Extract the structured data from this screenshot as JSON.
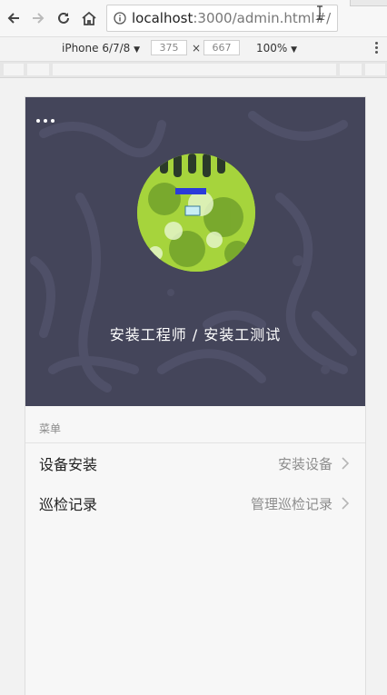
{
  "browser": {
    "url_host": "localhost",
    "url_path": ":3000/admin.html#/",
    "device": "iPhone 6/7/8",
    "width": "375",
    "height": "667",
    "dim_separator": "×",
    "zoom": "100%",
    "dropdown_glyph": "▼"
  },
  "app": {
    "user_name": "安装工程师 / 安装工测试",
    "menu_section_label": "菜单",
    "menu_items": [
      {
        "title": "设备安装",
        "extra": "安装设备",
        "icon": "chevron-right-icon"
      },
      {
        "title": "巡检记录",
        "extra": "管理巡检记录",
        "icon": "chevron-right-icon"
      }
    ]
  },
  "colors": {
    "hero_background": "#44455a",
    "page_background": "#f7f7f7",
    "secondary_text": "#8c8c8c"
  }
}
